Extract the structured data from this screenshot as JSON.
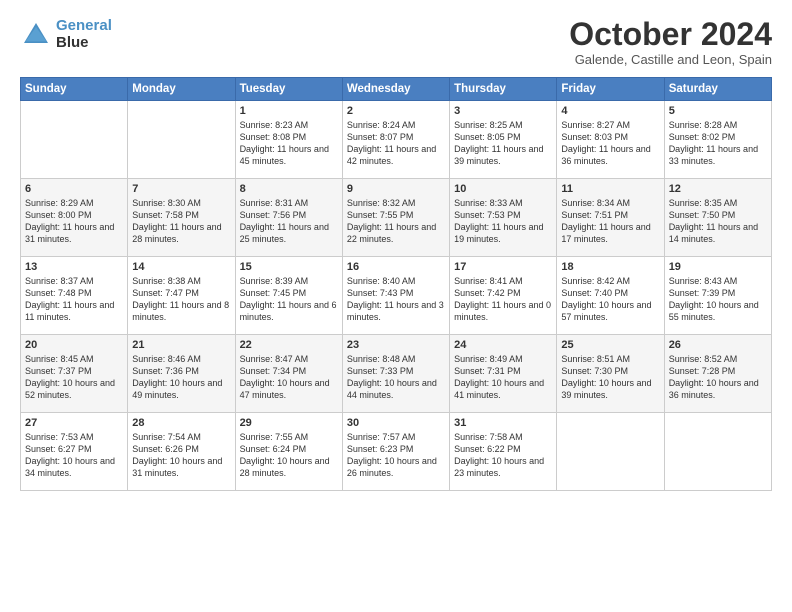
{
  "header": {
    "logo_line1": "General",
    "logo_line2": "Blue",
    "month": "October 2024",
    "location": "Galende, Castille and Leon, Spain"
  },
  "days_of_week": [
    "Sunday",
    "Monday",
    "Tuesday",
    "Wednesday",
    "Thursday",
    "Friday",
    "Saturday"
  ],
  "weeks": [
    [
      {
        "day": "",
        "info": ""
      },
      {
        "day": "",
        "info": ""
      },
      {
        "day": "1",
        "info": "Sunrise: 8:23 AM\nSunset: 8:08 PM\nDaylight: 11 hours and 45 minutes."
      },
      {
        "day": "2",
        "info": "Sunrise: 8:24 AM\nSunset: 8:07 PM\nDaylight: 11 hours and 42 minutes."
      },
      {
        "day": "3",
        "info": "Sunrise: 8:25 AM\nSunset: 8:05 PM\nDaylight: 11 hours and 39 minutes."
      },
      {
        "day": "4",
        "info": "Sunrise: 8:27 AM\nSunset: 8:03 PM\nDaylight: 11 hours and 36 minutes."
      },
      {
        "day": "5",
        "info": "Sunrise: 8:28 AM\nSunset: 8:02 PM\nDaylight: 11 hours and 33 minutes."
      }
    ],
    [
      {
        "day": "6",
        "info": "Sunrise: 8:29 AM\nSunset: 8:00 PM\nDaylight: 11 hours and 31 minutes."
      },
      {
        "day": "7",
        "info": "Sunrise: 8:30 AM\nSunset: 7:58 PM\nDaylight: 11 hours and 28 minutes."
      },
      {
        "day": "8",
        "info": "Sunrise: 8:31 AM\nSunset: 7:56 PM\nDaylight: 11 hours and 25 minutes."
      },
      {
        "day": "9",
        "info": "Sunrise: 8:32 AM\nSunset: 7:55 PM\nDaylight: 11 hours and 22 minutes."
      },
      {
        "day": "10",
        "info": "Sunrise: 8:33 AM\nSunset: 7:53 PM\nDaylight: 11 hours and 19 minutes."
      },
      {
        "day": "11",
        "info": "Sunrise: 8:34 AM\nSunset: 7:51 PM\nDaylight: 11 hours and 17 minutes."
      },
      {
        "day": "12",
        "info": "Sunrise: 8:35 AM\nSunset: 7:50 PM\nDaylight: 11 hours and 14 minutes."
      }
    ],
    [
      {
        "day": "13",
        "info": "Sunrise: 8:37 AM\nSunset: 7:48 PM\nDaylight: 11 hours and 11 minutes."
      },
      {
        "day": "14",
        "info": "Sunrise: 8:38 AM\nSunset: 7:47 PM\nDaylight: 11 hours and 8 minutes."
      },
      {
        "day": "15",
        "info": "Sunrise: 8:39 AM\nSunset: 7:45 PM\nDaylight: 11 hours and 6 minutes."
      },
      {
        "day": "16",
        "info": "Sunrise: 8:40 AM\nSunset: 7:43 PM\nDaylight: 11 hours and 3 minutes."
      },
      {
        "day": "17",
        "info": "Sunrise: 8:41 AM\nSunset: 7:42 PM\nDaylight: 11 hours and 0 minutes."
      },
      {
        "day": "18",
        "info": "Sunrise: 8:42 AM\nSunset: 7:40 PM\nDaylight: 10 hours and 57 minutes."
      },
      {
        "day": "19",
        "info": "Sunrise: 8:43 AM\nSunset: 7:39 PM\nDaylight: 10 hours and 55 minutes."
      }
    ],
    [
      {
        "day": "20",
        "info": "Sunrise: 8:45 AM\nSunset: 7:37 PM\nDaylight: 10 hours and 52 minutes."
      },
      {
        "day": "21",
        "info": "Sunrise: 8:46 AM\nSunset: 7:36 PM\nDaylight: 10 hours and 49 minutes."
      },
      {
        "day": "22",
        "info": "Sunrise: 8:47 AM\nSunset: 7:34 PM\nDaylight: 10 hours and 47 minutes."
      },
      {
        "day": "23",
        "info": "Sunrise: 8:48 AM\nSunset: 7:33 PM\nDaylight: 10 hours and 44 minutes."
      },
      {
        "day": "24",
        "info": "Sunrise: 8:49 AM\nSunset: 7:31 PM\nDaylight: 10 hours and 41 minutes."
      },
      {
        "day": "25",
        "info": "Sunrise: 8:51 AM\nSunset: 7:30 PM\nDaylight: 10 hours and 39 minutes."
      },
      {
        "day": "26",
        "info": "Sunrise: 8:52 AM\nSunset: 7:28 PM\nDaylight: 10 hours and 36 minutes."
      }
    ],
    [
      {
        "day": "27",
        "info": "Sunrise: 7:53 AM\nSunset: 6:27 PM\nDaylight: 10 hours and 34 minutes."
      },
      {
        "day": "28",
        "info": "Sunrise: 7:54 AM\nSunset: 6:26 PM\nDaylight: 10 hours and 31 minutes."
      },
      {
        "day": "29",
        "info": "Sunrise: 7:55 AM\nSunset: 6:24 PM\nDaylight: 10 hours and 28 minutes."
      },
      {
        "day": "30",
        "info": "Sunrise: 7:57 AM\nSunset: 6:23 PM\nDaylight: 10 hours and 26 minutes."
      },
      {
        "day": "31",
        "info": "Sunrise: 7:58 AM\nSunset: 6:22 PM\nDaylight: 10 hours and 23 minutes."
      },
      {
        "day": "",
        "info": ""
      },
      {
        "day": "",
        "info": ""
      }
    ]
  ]
}
